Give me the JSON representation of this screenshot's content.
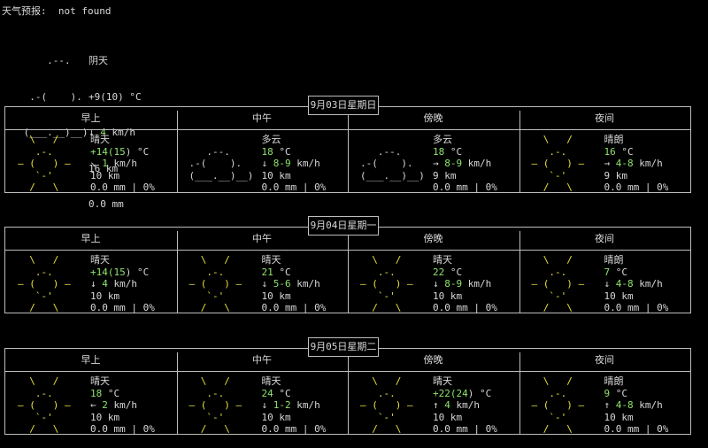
{
  "title": "天气预报:  not found",
  "current": {
    "art": [
      "     .--.    ",
      "  .-(    ).  ",
      " (___.__)__) "
    ],
    "condition": "阴天",
    "temp": "+9(10) °C",
    "wind_arrow": "↓",
    "wind_value": "4",
    "wind_unit": " km/h",
    "visibility": "16 km",
    "precip": "0.0 mm"
  },
  "period_labels": [
    "早上",
    "中午",
    "傍晚",
    "夜间"
  ],
  "days": [
    {
      "date": "9月03日星期日",
      "periods": [
        {
          "art_type": "sun",
          "condition": "晴天",
          "temp_pre": "+14(",
          "temp_hi": "15",
          "temp_post": ") °C",
          "temp_simple": "",
          "wind_arrow": "↘",
          "wind_value": "1",
          "wind_unit": " km/h",
          "visibility": "10 km",
          "precip": "0.0 mm | 0%"
        },
        {
          "art_type": "cloud",
          "condition": "多云",
          "temp_pre": "",
          "temp_hi": "",
          "temp_post": "",
          "temp_simple": "18",
          "wind_arrow": "↓",
          "wind_value": "8-9",
          "wind_unit": " km/h",
          "visibility": "10 km",
          "precip": "0.0 mm | 0%"
        },
        {
          "art_type": "cloud",
          "condition": "多云",
          "temp_pre": "",
          "temp_hi": "",
          "temp_post": "",
          "temp_simple": "18",
          "wind_arrow": "→",
          "wind_value": "8-9",
          "wind_unit": " km/h",
          "visibility": "9 km",
          "precip": "0.0 mm | 0%"
        },
        {
          "art_type": "sun",
          "condition": "晴朗",
          "temp_pre": "",
          "temp_hi": "",
          "temp_post": "",
          "temp_simple": "16",
          "wind_arrow": "→",
          "wind_value": "4-8",
          "wind_unit": " km/h",
          "visibility": "9 km",
          "precip": "0.0 mm | 0%"
        }
      ]
    },
    {
      "date": "9月04日星期一",
      "periods": [
        {
          "art_type": "sun",
          "condition": "晴天",
          "temp_pre": "+14(",
          "temp_hi": "15",
          "temp_post": ") °C",
          "temp_simple": "",
          "wind_arrow": "↓",
          "wind_value": "4",
          "wind_unit": " km/h",
          "visibility": "10 km",
          "precip": "0.0 mm | 0%"
        },
        {
          "art_type": "sun",
          "condition": "晴天",
          "temp_pre": "",
          "temp_hi": "",
          "temp_post": "",
          "temp_simple": "21",
          "wind_arrow": "↓",
          "wind_value": "5-6",
          "wind_unit": " km/h",
          "visibility": "10 km",
          "precip": "0.0 mm | 0%"
        },
        {
          "art_type": "sun",
          "condition": "晴天",
          "temp_pre": "",
          "temp_hi": "",
          "temp_post": "",
          "temp_simple": "22",
          "wind_arrow": "↓",
          "wind_value": "8-9",
          "wind_unit": " km/h",
          "visibility": "10 km",
          "precip": "0.0 mm | 0%"
        },
        {
          "art_type": "sun",
          "condition": "晴朗",
          "temp_pre": "",
          "temp_hi": "",
          "temp_post": "",
          "temp_simple": "7",
          "wind_arrow": "↓",
          "wind_value": "4-8",
          "wind_unit": " km/h",
          "visibility": "10 km",
          "precip": "0.0 mm | 0%"
        }
      ]
    },
    {
      "date": "9月05日星期二",
      "periods": [
        {
          "art_type": "sun",
          "condition": "晴天",
          "temp_pre": "",
          "temp_hi": "",
          "temp_post": "",
          "temp_simple": "18",
          "wind_arrow": "←",
          "wind_value": "2",
          "wind_unit": " km/h",
          "visibility": "10 km",
          "precip": "0.0 mm | 0%"
        },
        {
          "art_type": "sun",
          "condition": "晴天",
          "temp_pre": "",
          "temp_hi": "",
          "temp_post": "",
          "temp_simple": "24",
          "wind_arrow": "↓",
          "wind_value": "1-2",
          "wind_unit": " km/h",
          "visibility": "10 km",
          "precip": "0.0 mm | 0%"
        },
        {
          "art_type": "sun",
          "condition": "晴天",
          "temp_pre": "+22(",
          "temp_hi": "24",
          "temp_post": ") °C",
          "temp_simple": "",
          "wind_arrow": "↑",
          "wind_value": "4",
          "wind_unit": " km/h",
          "visibility": "10 km",
          "precip": "0.0 mm | 0%"
        },
        {
          "art_type": "sun",
          "condition": "晴朗",
          "temp_pre": "",
          "temp_hi": "",
          "temp_post": "",
          "temp_simple": "9",
          "wind_arrow": "↑",
          "wind_value": "4-8",
          "wind_unit": " km/h",
          "visibility": "10 km",
          "precip": "0.0 mm | 0%"
        }
      ]
    }
  ],
  "art": {
    "sun": [
      "  \\   /   ",
      "   .-.    ",
      "― (   ) ― ",
      "   `-'    ",
      "  /   \\   "
    ],
    "cloud": [
      "          ",
      "   .--.   ",
      ".-(    ). ",
      "(___.__)__)",
      "          "
    ]
  },
  "colors": {
    "sun": "#e8e23c",
    "temp": "#8fe36d",
    "text": "#d8d8d8",
    "border": "#bdbdbd"
  }
}
